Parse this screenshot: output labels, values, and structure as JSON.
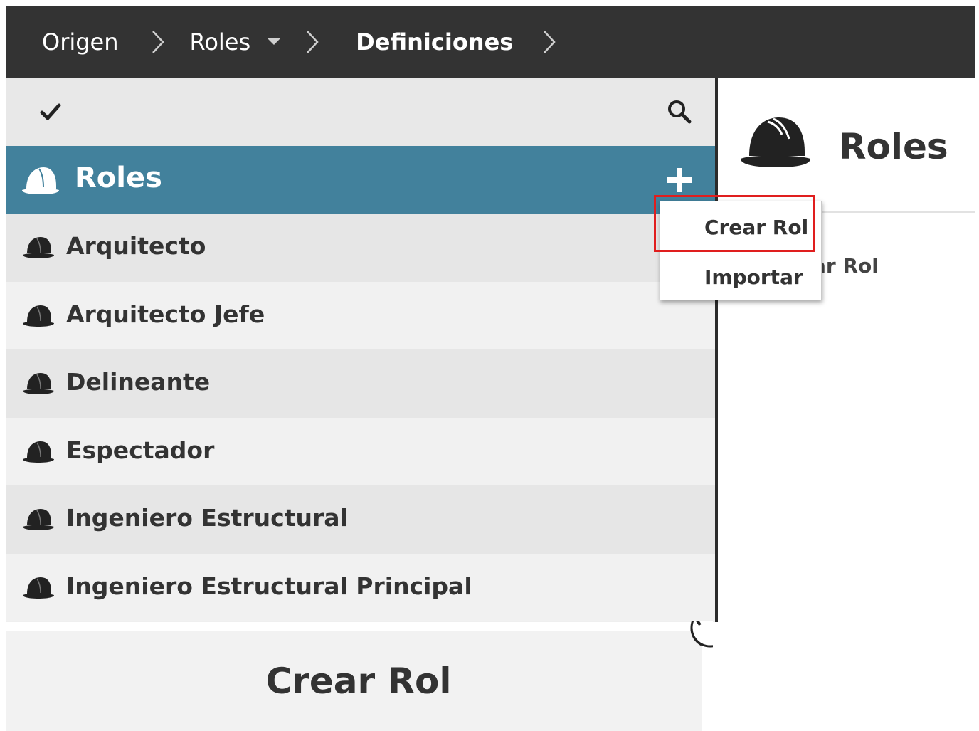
{
  "breadcrumb": {
    "items": [
      "Origen",
      "Roles",
      "Definiciones"
    ]
  },
  "left_panel": {
    "header_title": "Roles",
    "roles": [
      "Arquitecto",
      "Arquitecto Jefe",
      "Delineante",
      "Espectador",
      "Ingeniero Estructural",
      "Ingeniero Estructural Principal"
    ]
  },
  "right_panel": {
    "title": "Roles",
    "link_partial": "ear Rol"
  },
  "dropdown": {
    "items": [
      "Crear Rol",
      "Importar"
    ]
  },
  "bottom_panel": {
    "title": "Crear Rol"
  },
  "icons": {
    "breadcrumb_separator": "chevron-right-icon",
    "role_icon": "hard-hat-icon",
    "toolbar_left": "checkmark-icon",
    "toolbar_right": "search-icon",
    "add": "plus-icon",
    "dropdown_caret": "caret-down-icon"
  },
  "colors": {
    "topbar": "#333333",
    "section_header": "#42819c",
    "highlight": "#e01e1e"
  }
}
